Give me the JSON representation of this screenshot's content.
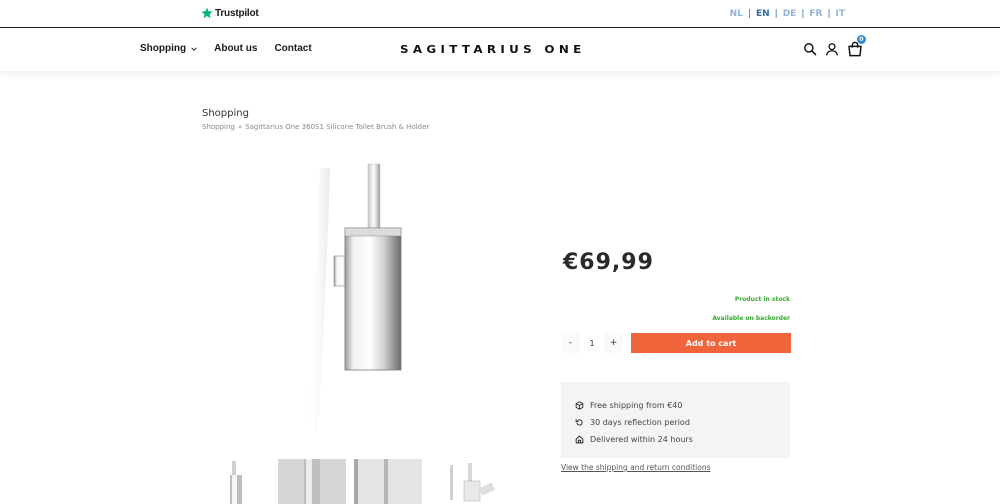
{
  "topbar": {
    "trustpilot_label": "Trustpilot",
    "languages": [
      "NL",
      "EN",
      "DE",
      "FR",
      "IT"
    ],
    "active_language": "EN"
  },
  "nav": {
    "shopping": "Shopping",
    "about": "About us",
    "contact": "Contact"
  },
  "brand": "SAGITTARIUS ONE",
  "cart": {
    "count": "0"
  },
  "page": {
    "title": "Shopping",
    "breadcrumb": {
      "root": "Shopping",
      "separator": "»",
      "current": "Sagittarius One 360S1 Silicone Toilet Brush & Holder"
    }
  },
  "product": {
    "price": "€69,99",
    "stock_status": "Product in stock",
    "backorder_status": "Available on backorder",
    "quantity": "1",
    "minus_label": "-",
    "plus_label": "+",
    "add_to_cart": "Add to cart",
    "usps": [
      {
        "icon": "package-icon",
        "text": "Free shipping from €40"
      },
      {
        "icon": "return-icon",
        "text": "30 days reflection period"
      },
      {
        "icon": "home-icon",
        "text": "Delivered within 24 hours"
      }
    ],
    "shipping_link": "View the shipping and return conditions"
  },
  "colors": {
    "accent": "#f0643c",
    "stock_green": "#38a935",
    "lang_active": "#2d6ca8",
    "lang_inactive": "#8fb4d8",
    "badge": "#2d8ad6"
  }
}
